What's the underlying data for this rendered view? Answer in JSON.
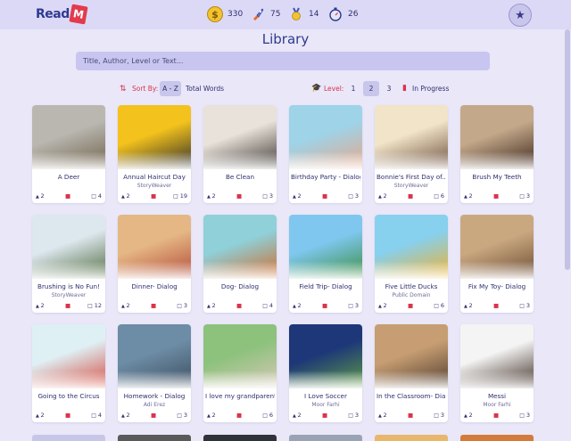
{
  "header": {
    "logo_text": "Read",
    "logo_badge": "M",
    "stats": [
      {
        "icon": "coin-icon",
        "value": "330",
        "color": "#e7b21d"
      },
      {
        "icon": "rocket-icon",
        "value": "75",
        "color": "#4e6bd4"
      },
      {
        "icon": "medal-icon",
        "value": "14",
        "color": "#e7b21d"
      },
      {
        "icon": "stopwatch-icon",
        "value": "26",
        "color": "#3f4b8c"
      }
    ]
  },
  "page": {
    "title": "Library",
    "search_placeholder": "Title, Author, Level or Text..."
  },
  "sort": {
    "label": "Sort By:",
    "options": [
      "A - Z",
      "Total Words"
    ],
    "selected": "A - Z"
  },
  "level": {
    "label": "Level:",
    "options": [
      "1",
      "2",
      "3"
    ],
    "selected": "2",
    "progress_label": "In Progress"
  },
  "books": [
    {
      "title": "A Deer",
      "author": "",
      "level": "2",
      "pages": "4",
      "colors": [
        "#b9b7b0",
        "#6e6049"
      ]
    },
    {
      "title": "Annual Haircut Day",
      "author": "StoryWeaver",
      "level": "2",
      "pages": "19",
      "colors": [
        "#f3c21c",
        "#2a2a2a"
      ]
    },
    {
      "title": "Be Clean",
      "author": "",
      "level": "2",
      "pages": "3",
      "colors": [
        "#e8e2da",
        "#3b3530"
      ]
    },
    {
      "title": "Birthday Party - Dialog",
      "author": "",
      "level": "2",
      "pages": "3",
      "colors": [
        "#9ed3e8",
        "#e6a789"
      ]
    },
    {
      "title": "Bonnie's First Day of...",
      "author": "StoryWeaver",
      "level": "2",
      "pages": "6",
      "colors": [
        "#f1e4c8",
        "#6a4c3a"
      ]
    },
    {
      "title": "Brush My Teeth",
      "author": "",
      "level": "2",
      "pages": "3",
      "colors": [
        "#c3a88a",
        "#3a2418"
      ]
    },
    {
      "title": "Brushing is No Fun!",
      "author": "StoryWeaver",
      "level": "2",
      "pages": "12",
      "colors": [
        "#dde7ee",
        "#4f6a3d"
      ]
    },
    {
      "title": "Dinner- Dialog",
      "author": "",
      "level": "2",
      "pages": "3",
      "colors": [
        "#e5b785",
        "#b34a36"
      ]
    },
    {
      "title": "Dog- Dialog",
      "author": "",
      "level": "2",
      "pages": "4",
      "colors": [
        "#8fd0d9",
        "#d06a2a"
      ]
    },
    {
      "title": "Field Trip- Dialog",
      "author": "",
      "level": "2",
      "pages": "3",
      "colors": [
        "#7fc7ef",
        "#3a8d3f"
      ]
    },
    {
      "title": "Five Little Ducks",
      "author": "Public Domain",
      "level": "2",
      "pages": "6",
      "colors": [
        "#87d0ee",
        "#f0b02c"
      ]
    },
    {
      "title": "Fix My Toy- Dialog",
      "author": "",
      "level": "2",
      "pages": "3",
      "colors": [
        "#c9a880",
        "#6b4b33"
      ]
    },
    {
      "title": "Going to the Circus",
      "author": "",
      "level": "2",
      "pages": "4",
      "colors": [
        "#dff0f5",
        "#d44a3c"
      ]
    },
    {
      "title": "Homework - Dialog",
      "author": "Adi Erez",
      "level": "2",
      "pages": "3",
      "colors": [
        "#6d8ca5",
        "#3b4d5f"
      ]
    },
    {
      "title": "I love my grandparents",
      "author": "",
      "level": "2",
      "pages": "6",
      "colors": [
        "#8dc27d",
        "#d8c8b7"
      ]
    },
    {
      "title": "I Love Soccer",
      "author": "Moor Farhi",
      "level": "2",
      "pages": "3",
      "colors": [
        "#1d3778",
        "#5f9e45"
      ]
    },
    {
      "title": "In the Classroom- Dialog",
      "author": "",
      "level": "2",
      "pages": "3",
      "colors": [
        "#c79e73",
        "#4f3b2c"
      ]
    },
    {
      "title": "Messi",
      "author": "Moor Farhi",
      "level": "2",
      "pages": "3",
      "colors": [
        "#f4f4f4",
        "#3b2a20"
      ]
    }
  ],
  "next_row_colors": [
    "#c8c6e8",
    "#5a5a5a",
    "#2f3238",
    "#9aa3b5",
    "#e8b76c",
    "#d47a3a"
  ]
}
